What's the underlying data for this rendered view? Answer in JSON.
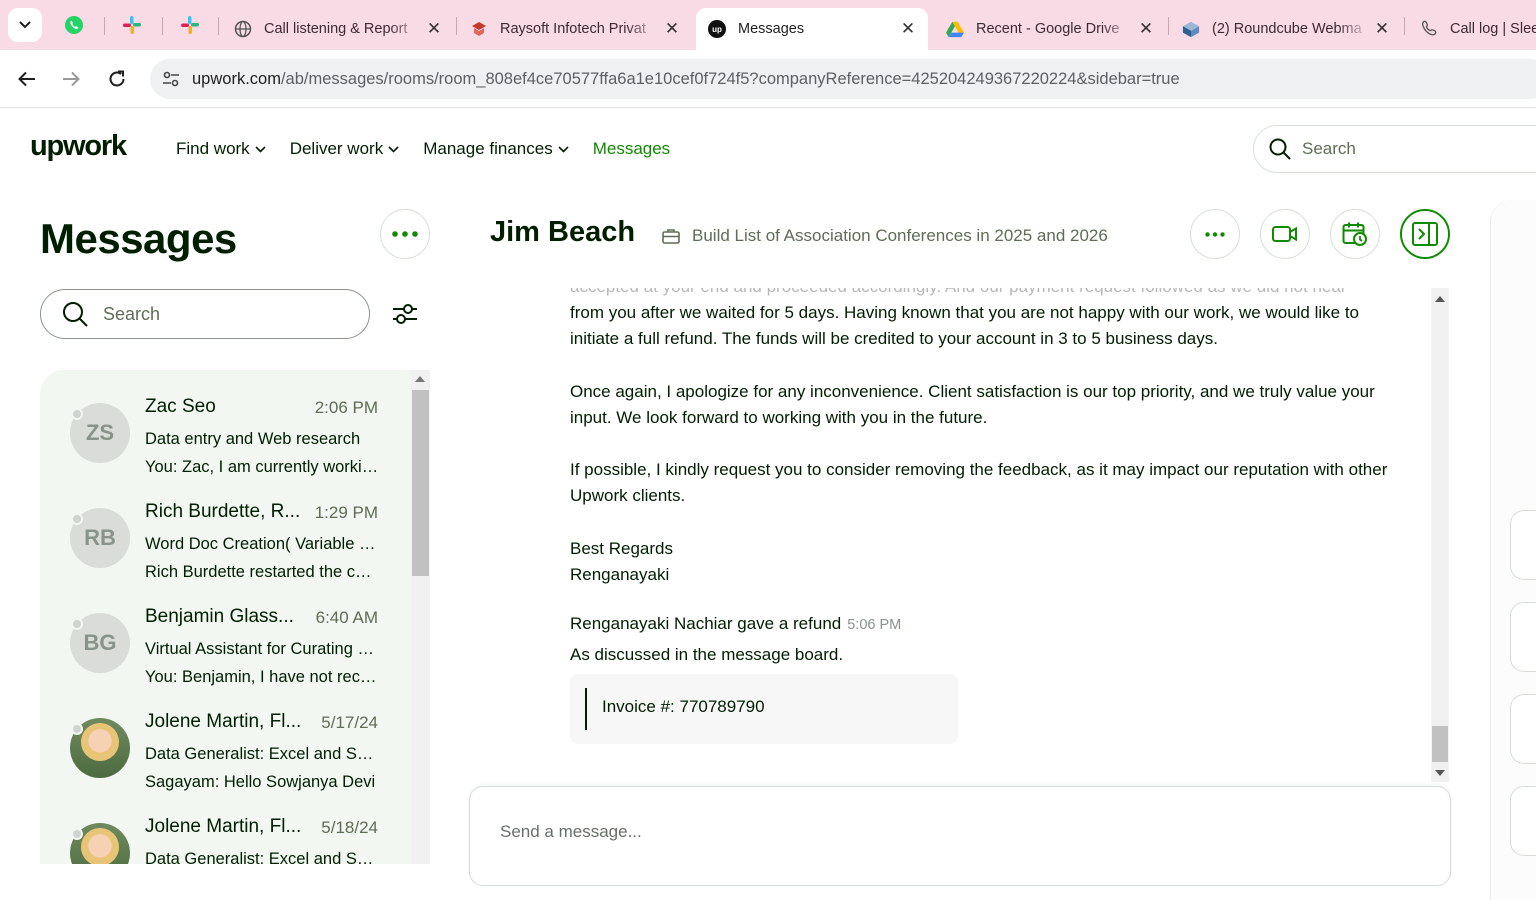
{
  "browser": {
    "tabs": [
      {
        "title": "Call listening & Report",
        "icon": "globe-icon"
      },
      {
        "title": "Raysoft Infotech Privat",
        "icon": "raysoft-icon"
      },
      {
        "title": "Messages",
        "icon": "upwork-icon"
      },
      {
        "title": "Recent - Google Drive",
        "icon": "google-drive-icon"
      },
      {
        "title": "(2) Roundcube Webma",
        "icon": "roundcube-icon"
      },
      {
        "title": "Call log | Slee",
        "icon": "phone-icon"
      }
    ],
    "url_host": "upwork.com",
    "url_path": "/ab/messages/rooms/room_808ef4ce70577ffa6a1e10cef0f724f5?companyReference=425204249367220224&sidebar=true"
  },
  "header": {
    "logo": "upwork",
    "nav": {
      "find_work": "Find work",
      "deliver_work": "Deliver work",
      "manage_finances": "Manage finances",
      "messages": "Messages"
    },
    "search_placeholder": "Search"
  },
  "sidebar": {
    "title": "Messages",
    "search_placeholder": "Search",
    "conversations": [
      {
        "initials": "ZS",
        "name": "Zac Seo",
        "time": "2:06 PM",
        "line1": "Data entry and Web research",
        "line2": "You: Zac, I am currently working on it"
      },
      {
        "initials": "RB",
        "name": "Rich Burdette, R...",
        "time": "1:29 PM",
        "line1": "Word Doc Creation( Variable Data)",
        "line2": "Rich Burdette restarted the contract"
      },
      {
        "initials": "BG",
        "name": "Benjamin Glass...",
        "time": "6:40 AM",
        "line1": "Virtual Assistant for Curating Content",
        "line2": "You: Benjamin, I have not received it"
      },
      {
        "initials": "",
        "name": "Jolene Martin, Fl...",
        "time": "5/17/24",
        "line1": "Data Generalist: Excel and Sheets",
        "line2": "Sagayam: Hello Sowjanya Devi"
      },
      {
        "initials": "",
        "name": "Jolene Martin, Fl...",
        "time": "5/18/24",
        "line1": "Data Generalist: Excel and Sheets",
        "line2": ""
      }
    ]
  },
  "room": {
    "name": "Jim Beach",
    "job": "Build List of Association Conferences in 2025 and 2026"
  },
  "messages": {
    "faded_line": "accepted at your end and proceeded accordingly. And our payment request followed as we did not hear",
    "p1": "from you after we waited for 5 days. Having known that you are not happy with our work, we would like to initiate a full refund. The funds will be credited to your account in 3 to 5 business days.",
    "p2": "Once again, I apologize for any inconvenience. Client satisfaction is our top priority, and we truly value your input. We look forward to working with you in the future.",
    "p3": "If possible, I kindly request you to consider removing the feedback, as it may impact our reputation with other Upwork clients.",
    "regards": "Best Regards",
    "signature": "Renganayaki",
    "refund_event": "Renganayaki Nachiar gave a refund",
    "refund_time": "5:06 PM",
    "refund_note": "As discussed in the message board.",
    "invoice": "Invoice #: 770789790"
  },
  "composer": {
    "placeholder": "Send a message..."
  },
  "colors": {
    "brand_green": "#108a00",
    "tab_strip": "#f9dbe6",
    "text": "#001e00"
  }
}
